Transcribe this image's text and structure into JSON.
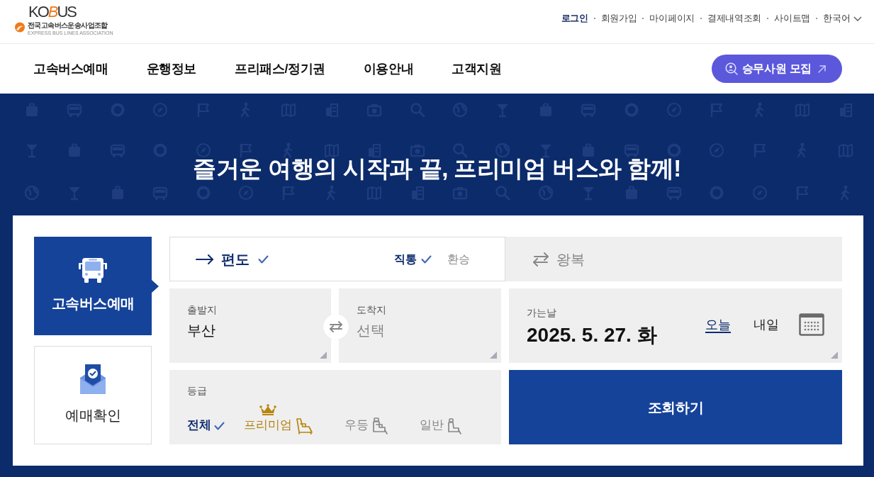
{
  "header": {
    "logo": {
      "brand": [
        {
          "text": "KO",
          "accent": false
        },
        {
          "text": "B",
          "accent": true
        },
        {
          "text": "US",
          "accent": false
        }
      ],
      "org_name": "전국고속버스운송사업조합",
      "org_name_en": "EXPRESS BUS LINES ASSOCIATION"
    },
    "util_links": [
      {
        "label": "로그인",
        "emphasized": true
      },
      {
        "label": "회원가입",
        "emphasized": false
      },
      {
        "label": "마이페이지",
        "emphasized": false
      },
      {
        "label": "결제내역조회",
        "emphasized": false
      },
      {
        "label": "사이트맵",
        "emphasized": false
      }
    ],
    "language": {
      "label": "한국어"
    }
  },
  "nav": {
    "items": [
      "고속버스예매",
      "운행정보",
      "프리패스/정기권",
      "이용안내",
      "고객지원"
    ],
    "recruit_button": {
      "label": "승무사원 모집"
    }
  },
  "banner": {
    "headline": "즐거운 여행의 시작과 끝, 프리미엄 버스와 함께!"
  },
  "booking": {
    "side_tabs": [
      {
        "label": "고속버스예매",
        "selected": true,
        "kind": "bus"
      },
      {
        "label": "예매확인",
        "selected": false,
        "kind": "ticket"
      }
    ],
    "trip_types": [
      {
        "label": "편도",
        "selected": true,
        "kind": "one-way"
      },
      {
        "label": "왕복",
        "selected": false,
        "kind": "round-trip"
      }
    ],
    "route_types": [
      {
        "label": "직통",
        "selected": true
      },
      {
        "label": "환승",
        "selected": false
      }
    ],
    "departure": {
      "label": "출발지",
      "value": "부산"
    },
    "arrival": {
      "label": "도착지",
      "placeholder": "선택"
    },
    "date": {
      "label": "가는날",
      "value": "2025. 5. 27. 화",
      "quick_dates": [
        {
          "label": "오늘",
          "selected": true
        },
        {
          "label": "내일",
          "selected": false
        }
      ]
    },
    "grade": {
      "label": "등급",
      "options": [
        {
          "label": "전체",
          "selected": true,
          "kind": "all"
        },
        {
          "label": "프리미엄",
          "selected": false,
          "kind": "premium"
        },
        {
          "label": "우등",
          "selected": false,
          "kind": "deluxe"
        },
        {
          "label": "일반",
          "selected": false,
          "kind": "standard"
        }
      ]
    },
    "search_button": "조회하기"
  }
}
